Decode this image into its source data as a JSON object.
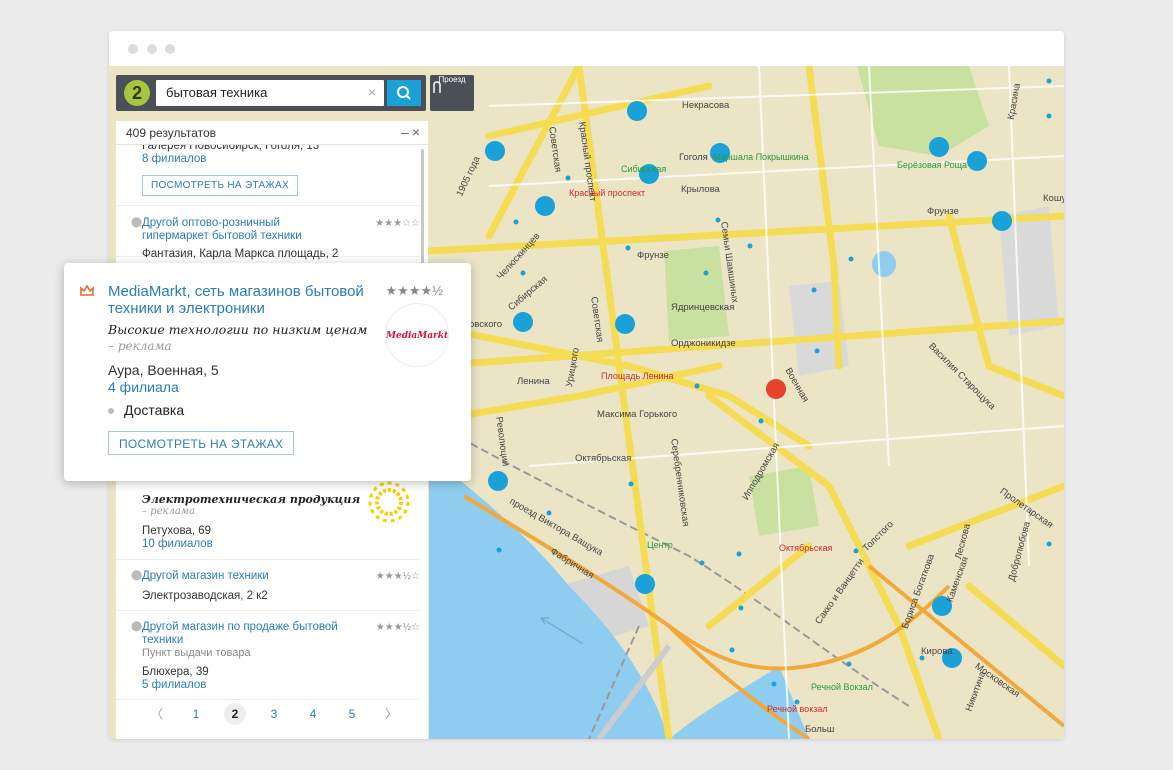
{
  "search": {
    "query": "бытовая техника",
    "clear_symbol": "×",
    "route_label": "Проезд"
  },
  "logo": {
    "text": "2"
  },
  "panel": {
    "results_count": "409 результатов",
    "item0": {
      "partial_text": "Галерея Новосибирск, Гоголя, 13",
      "branches": "8 филиалов",
      "button": "ПОСМОТРЕТЬ НА ЭТАЖАХ"
    },
    "item1": {
      "title": "Другой оптово-розничный гипермаркет бытовой техники",
      "address": "Фантазия, Карла Маркса площадь, 2",
      "rating": 3
    },
    "item2": {
      "slogan": "Электротехническая продукция",
      "ad_note": "– реклама",
      "address": "Петухова, 69",
      "branches": "10 филиалов"
    },
    "item3": {
      "title": "Другой магазин техники",
      "address": "Электрозаводская, 2 к2",
      "rating": 3.5
    },
    "item4": {
      "title": "Другой магазин по продаже бытовой техники",
      "subtitle": "Пункт выдачи товара",
      "address": "Блюхера, 39",
      "branches": "5 филиалов",
      "rating": 3.5
    },
    "pager": {
      "prev": "〈",
      "pages": [
        "1",
        "2",
        "3",
        "4",
        "5"
      ],
      "current": "2",
      "next": "〉"
    }
  },
  "popup": {
    "title": "MediaMarkt, сеть магазинов бытовой техники и электроники",
    "rating": 4.5,
    "slogan": "Высокие технологии по низким ценам",
    "ad_note": "– реклама",
    "logo_text": "MediaMarkt",
    "address": "Аура, Военная, 5",
    "branches": "4 филиала",
    "feature": "Доставка",
    "button": "ПОСМОТРЕТЬ НА ЭТАЖАХ"
  },
  "map_labels": {
    "nekrasova": "Некрасова",
    "krasny_prospekt": "Красный проспект",
    "gogolya": "Гоголя",
    "sibirskaya_metro": "Сибирская",
    "marshala": "Маршала Покрышкина",
    "berezovaya": "Берёзовая Роща",
    "krasny_metro": "Красный проспект",
    "krylova": "Крылова",
    "frunze": "Фрунзе",
    "frunze2": "Фрунзе",
    "chelyuskintsev": "Челюскинцев",
    "year1905": "1905 года",
    "sibirskaya": "Сибирская",
    "sovetskaya": "Советская",
    "sovetskaya2": "Советская",
    "shamshinykh": "Семьи Шамшиных",
    "yadrintsevskaya": "Ядринцевская",
    "ordzhonikidze": "Орджоникидзе",
    "voennaya": "Военная",
    "ploshchad": "Площадь Ленина",
    "lenina": "Ленина",
    "uritskogo": "Урицкого",
    "revolyutsii": "Революции",
    "maksima": "Максима Горького",
    "oktyabrskaya": "Октябрьская",
    "serebrennikovskaya": "Серебренниковская",
    "ippodromskaya": "Ипподромская",
    "vashchuka": "проезд Виктора Ващука",
    "fabrichnaya": "Фабричная",
    "tsentr": "Центр",
    "oktyabrskaya_metro": "Октябрьская",
    "tolstogo": "Толстого",
    "sakko": "Сакко и Ванцетти",
    "kirova": "Кирова",
    "boris": "Бориса Богаткова",
    "leskova": "Лесковa",
    "dobrolyubova": "Добролюбова",
    "proletarskaya": "Пролетарская",
    "vasiliya": "Василия Старощука",
    "moskovskaya": "Московская",
    "nikitina": "Никитина",
    "rechnoy": "Речной Вокзал",
    "rechnoy_metro": "Речной вокзал",
    "krasina": "Красина",
    "kosh": "Кошу",
    "kamenskaya": "Каменская",
    "fruze_right": "Фрунзе",
    "selgovskogo": "овского",
    "bolsh": "Больш"
  },
  "colors": {
    "accent": "#1aa1d8",
    "link": "#2a7db8",
    "pin": "#1aa1d8",
    "pin_active": "#e8412c",
    "road": "#f5dc55"
  }
}
